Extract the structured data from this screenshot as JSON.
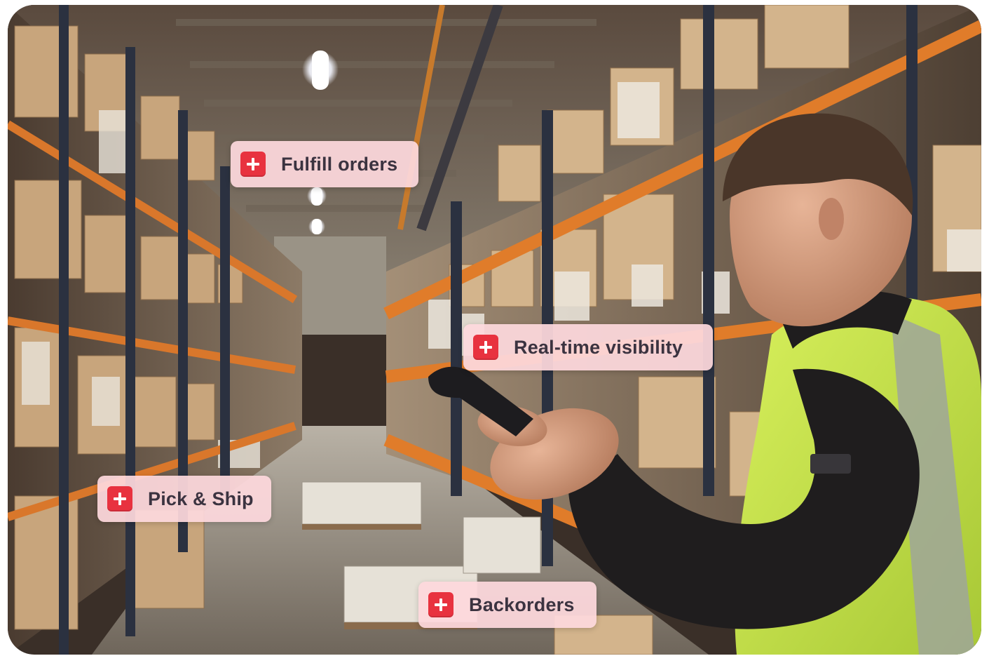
{
  "photo": {
    "subject": "warehouse worker in hi-vis vest scanning with handheld barcode scanner between shelving aisles",
    "colors": {
      "shelf_orange": "#d9772b",
      "upright_navy": "#2b3140",
      "vest_yellow": "#c7e84a",
      "jacket_black": "#1f1d1e",
      "cardboard": "#c9a57b",
      "chip_background": "#fdd8dd",
      "icon_red": "#e8323f",
      "label_text": "#3b3340"
    }
  },
  "tags": [
    {
      "id": "fulfill",
      "label": "Fulfill orders",
      "icon": "plus-icon"
    },
    {
      "id": "realtime",
      "label": "Real-time visibility",
      "icon": "plus-icon"
    },
    {
      "id": "pick",
      "label": "Pick & Ship",
      "icon": "plus-icon"
    },
    {
      "id": "back",
      "label": "Backorders",
      "icon": "plus-icon"
    }
  ]
}
